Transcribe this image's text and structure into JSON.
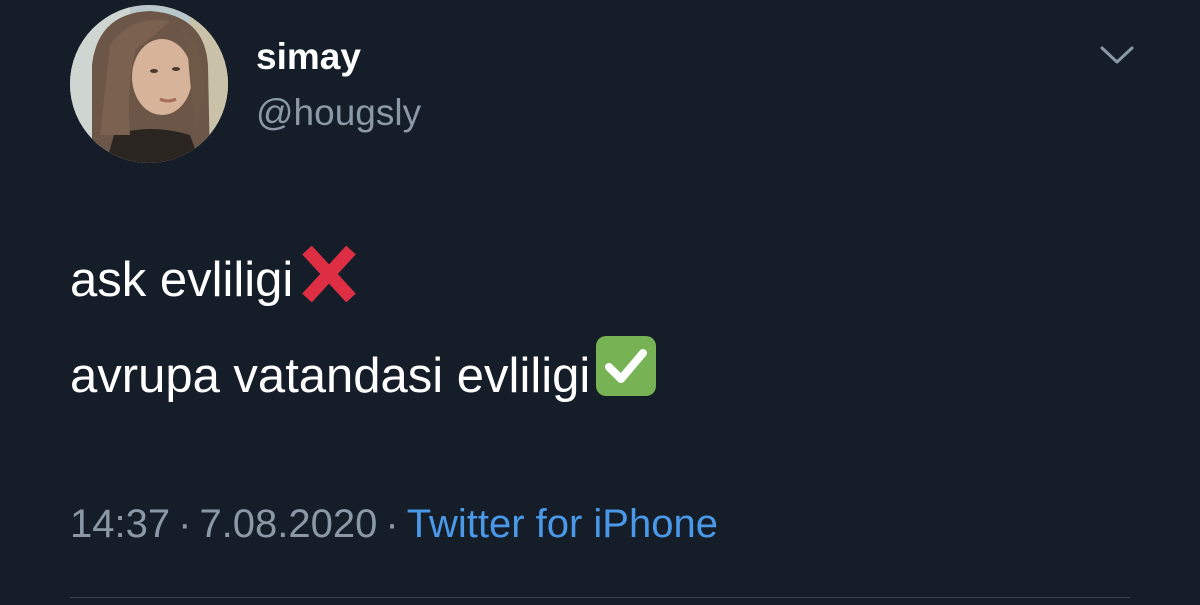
{
  "tweet": {
    "author": {
      "display_name": "simay",
      "handle": "@hougsly",
      "avatar_icon": "profile-photo"
    },
    "menu_icon": "chevron-down-icon",
    "text_lines": [
      {
        "text": "ask evliligi",
        "emoji": "cross-mark-icon"
      },
      {
        "text": "avrupa vatandasi evliligi",
        "emoji": "check-mark-button-icon"
      }
    ],
    "meta": {
      "time": "14:37",
      "separator": "·",
      "date": "7.08.2020",
      "source": "Twitter for iPhone"
    }
  },
  "colors": {
    "background": "#151d29",
    "primary_text": "#ffffff",
    "secondary_text": "#8b98a5",
    "link": "#4a99e9",
    "cross_red": "#dd2e44",
    "check_green": "#77b255"
  }
}
